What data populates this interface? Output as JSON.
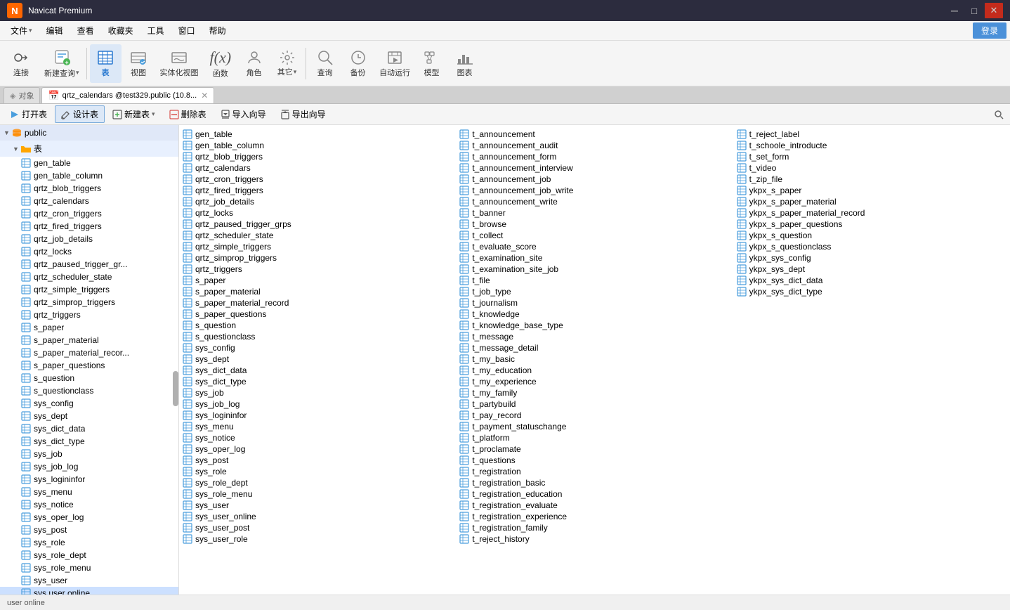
{
  "window": {
    "title": "Navicat Premium",
    "app_icon": "N"
  },
  "title_bar": {
    "controls": {
      "minimize": "─",
      "maximize": "□",
      "close": "✕"
    }
  },
  "menu_bar": {
    "items": [
      "文件",
      "编辑",
      "查看",
      "收藏夹",
      "工具",
      "窗口",
      "帮助"
    ],
    "login_label": "登录"
  },
  "toolbar": {
    "buttons": [
      {
        "id": "connect",
        "icon": "🔌",
        "label": "连接"
      },
      {
        "id": "new-query",
        "icon": "📋",
        "label": "新建查询"
      },
      {
        "id": "table",
        "icon": "⊞",
        "label": "表",
        "active": true
      },
      {
        "id": "view",
        "icon": "👁",
        "label": "视图"
      },
      {
        "id": "materialized-view",
        "icon": "👁",
        "label": "实体化视图"
      },
      {
        "id": "function",
        "icon": "ƒ",
        "label": "函数"
      },
      {
        "id": "role",
        "icon": "👤",
        "label": "角色"
      },
      {
        "id": "other",
        "icon": "⚙",
        "label": "其它"
      },
      {
        "id": "query",
        "icon": "🔍",
        "label": "查询"
      },
      {
        "id": "backup",
        "icon": "💾",
        "label": "备份"
      },
      {
        "id": "auto-run",
        "icon": "▶",
        "label": "自动运行"
      },
      {
        "id": "model",
        "icon": "📊",
        "label": "模型"
      },
      {
        "id": "chart",
        "icon": "📈",
        "label": "图表"
      }
    ]
  },
  "tree": {
    "root_label": "public",
    "table_group": "表",
    "items": [
      "gen_table",
      "gen_table_column",
      "qrtz_blob_triggers",
      "qrtz_calendars",
      "qrtz_cron_triggers",
      "qrtz_fired_triggers",
      "qrtz_job_details",
      "qrtz_locks",
      "qrtz_paused_trigger_gr...",
      "qrtz_scheduler_state",
      "qrtz_simple_triggers",
      "qrtz_simprop_triggers",
      "qrtz_triggers",
      "s_paper",
      "s_paper_material",
      "s_paper_material_recor...",
      "s_paper_questions",
      "s_question",
      "s_questionclass",
      "sys_config",
      "sys_dept",
      "sys_dict_data",
      "sys_dict_type",
      "sys_job",
      "sys_job_log",
      "sys_logininfor",
      "sys_menu",
      "sys_notice",
      "sys_oper_log",
      "sys_post",
      "sys_role",
      "sys_role_dept",
      "sys_role_menu",
      "sys_user",
      "sys user online"
    ]
  },
  "tab": {
    "label": "qrtz_calendars @test329.public (10.8..."
  },
  "action_bar": {
    "buttons": [
      {
        "id": "open",
        "icon": "▶",
        "label": "打开表"
      },
      {
        "id": "design",
        "icon": "✏",
        "label": "设计表",
        "active": true
      },
      {
        "id": "new-table",
        "icon": "➕",
        "label": "新建表"
      },
      {
        "id": "delete",
        "icon": "✕",
        "label": "删除表"
      },
      {
        "id": "import",
        "icon": "⬆",
        "label": "导入向导"
      },
      {
        "id": "export",
        "icon": "⬇",
        "label": "导出向导"
      }
    ]
  },
  "table_columns": [
    {
      "tables": [
        "gen_table",
        "gen_table_column",
        "qrtz_blob_triggers",
        "qrtz_calendars",
        "qrtz_cron_triggers",
        "qrtz_fired_triggers",
        "qrtz_job_details",
        "qrtz_locks",
        "qrtz_paused_trigger_grps",
        "qrtz_scheduler_state",
        "qrtz_simple_triggers",
        "qrtz_simprop_triggers",
        "qrtz_triggers",
        "s_paper",
        "s_paper_material",
        "s_paper_material_record",
        "s_paper_questions",
        "s_question",
        "s_questionclass",
        "sys_config",
        "sys_dept",
        "sys_dict_data",
        "sys_dict_type",
        "sys_job",
        "sys_job_log",
        "sys_logininfor",
        "sys_menu",
        "sys_notice",
        "sys_oper_log",
        "sys_post",
        "sys_role",
        "sys_role_dept",
        "sys_role_menu",
        "sys_user",
        "sys_user_online",
        "sys_user_post",
        "sys_user_role"
      ]
    },
    {
      "tables": [
        "t_announcement",
        "t_announcement_audit",
        "t_announcement_form",
        "t_announcement_interview",
        "t_announcement_job",
        "t_announcement_job_write",
        "t_announcement_write",
        "t_banner",
        "t_browse",
        "t_collect",
        "t_evaluate_score",
        "t_examination_site",
        "t_examination_site_job",
        "t_file",
        "t_job_type",
        "t_journalism",
        "t_knowledge",
        "t_knowledge_base_type",
        "t_message",
        "t_message_detail",
        "t_my_basic",
        "t_my_education",
        "t_my_experience",
        "t_my_family",
        "t_partybuild",
        "t_pay_record",
        "t_payment_statuschange",
        "t_platform",
        "t_proclamate",
        "t_questions",
        "t_registration",
        "t_registration_basic",
        "t_registration_education",
        "t_registration_evaluate",
        "t_registration_experience",
        "t_registration_family",
        "t_reject_history"
      ]
    },
    {
      "tables": [
        "t_reject_label",
        "t_schoole_introducte",
        "t_set_form",
        "t_video",
        "t_zip_file",
        "ykpx_s_paper",
        "ykpx_s_paper_material",
        "ykpx_s_paper_material_record",
        "ykpx_s_paper_questions",
        "ykpx_s_question",
        "ykpx_s_questionclass",
        "ykpx_sys_config",
        "ykpx_sys_dept",
        "ykpx_sys_dict_data",
        "ykpx_sys_dict_type"
      ]
    }
  ],
  "status_bar": {
    "text": "user online"
  },
  "colors": {
    "accent_blue": "#2878d0",
    "table_icon": "#4a9edd",
    "active_design": "#dce8f7",
    "titlebar_bg": "#2c2c3e"
  }
}
